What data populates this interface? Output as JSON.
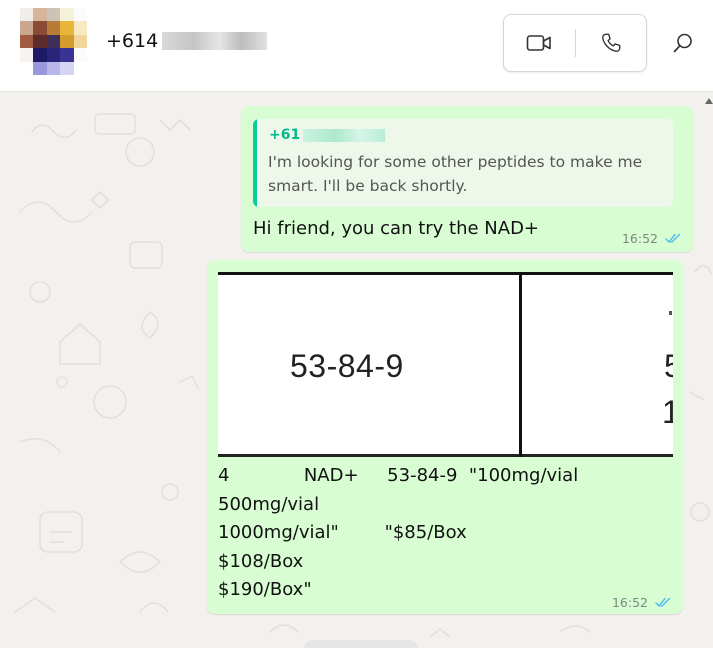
{
  "header": {
    "contact_name": "+61",
    "contact_name_partial": "4",
    "video_call_icon": "video-camera-icon",
    "voice_call_icon": "phone-icon",
    "search_icon": "search-icon"
  },
  "messages": [
    {
      "quoted": {
        "sender": "+61",
        "text": "I'm looking for some other peptides to make me smart. I'll be back shortly."
      },
      "text": "Hi friend, you can try the NAD+",
      "time": "16:52",
      "status": "read"
    },
    {
      "image": {
        "cell_text": "53-84-9",
        "cut_text_1": "5",
        "cut_text_2": "1"
      },
      "text": "4             NAD+     53-84-9  \"100mg/vial\n500mg/vial\n1000mg/vial\"        \"$85/Box\n$108/Box\n$190/Box\"",
      "time": "16:52",
      "status": "read"
    }
  ],
  "colors": {
    "bubble_out": "#d9fdd3",
    "quote_accent": "#06cf9c",
    "read_tick": "#53bdeb",
    "chat_bg": "#f3f1ee"
  }
}
